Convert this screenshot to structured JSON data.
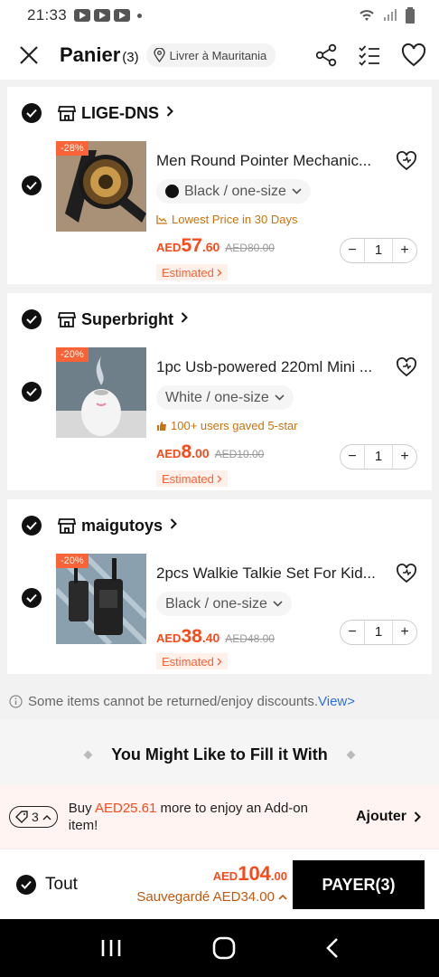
{
  "status": {
    "time": "21:33"
  },
  "header": {
    "title": "Panier",
    "count": "(3)",
    "location": "Livrer à Mauritania"
  },
  "shops": [
    {
      "name": "LIGE-DNS",
      "item": {
        "discount": "-28%",
        "name": "Men Round Pointer Mechanic...",
        "variant": "Black / one-size",
        "tag": "Lowest Price in 30 Days",
        "price_currency": "AED",
        "price_int": "57",
        "price_dec": ".60",
        "old_price": "AED80.00",
        "estimated": "Estimated",
        "qty": "1"
      }
    },
    {
      "name": "Superbright",
      "item": {
        "discount": "-20%",
        "name": "1pc Usb-powered 220ml Mini ...",
        "variant": "White / one-size",
        "tag": "100+ users gaved 5-star",
        "price_currency": "AED",
        "price_int": "8",
        "price_dec": ".00",
        "old_price": "AED10.00",
        "estimated": "Estimated",
        "qty": "1"
      }
    },
    {
      "name": "maigutoys",
      "item": {
        "discount": "-20%",
        "name": "2pcs Walkie Talkie Set For Kid...",
        "variant": "Black / one-size",
        "price_currency": "AED",
        "price_int": "38",
        "price_dec": ".40",
        "old_price": "AED48.00",
        "estimated": "Estimated",
        "qty": "1"
      }
    }
  ],
  "notice": {
    "text": "Some items cannot be returned/enjoy discounts.",
    "link": "View>"
  },
  "fill_section": {
    "title": "You Might Like to Fill it With"
  },
  "addon": {
    "coupon_count": "3",
    "prefix": "Buy ",
    "amount": "AED25.61",
    "suffix": " more to enjoy an Add-on item!",
    "action": "Ajouter"
  },
  "checkout": {
    "select_all": "Tout",
    "total_currency": "AED",
    "total_int": "104",
    "total_dec": ".00",
    "saved": "Sauvegardé AED34.00",
    "pay_label": "PAYER(3)"
  },
  "colors": {
    "accent": "#fa4a1a",
    "tag_orange": "#c87310",
    "link": "#2f6fdb"
  }
}
